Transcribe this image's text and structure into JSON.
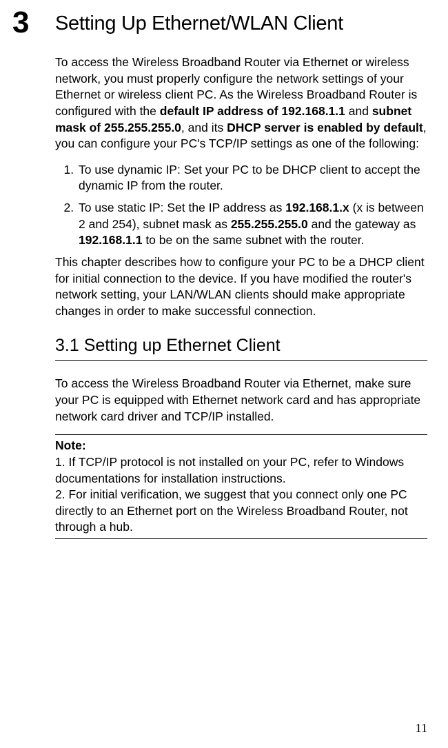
{
  "chapter": {
    "number": "3",
    "title": "Setting Up Ethernet/WLAN Client"
  },
  "intro": {
    "part1": "To access the Wireless Broadband Router via Ethernet or wireless network, you must properly configure the network settings of your Ethernet or wireless client PC. As the Wireless Broadband Router is configured with the ",
    "bold1": "default IP address of 192.168.1.1",
    "mid1": " and ",
    "bold2": "subnet mask of 255.255.255.0",
    "mid2": ", and its ",
    "bold3": "DHCP server is enabled by default",
    "part2": ", you can configure your PC's TCP/IP settings as one of the following:"
  },
  "list": {
    "item1": "To use dynamic IP: Set your PC to be DHCP client to accept the dynamic IP from the router.",
    "item2_a": "To use static IP: Set the IP address as ",
    "item2_b1": "192.168.1.x",
    "item2_c": " (x is between 2 and 254), subnet mask as ",
    "item2_b2": "255.255.255.0",
    "item2_d": " and the gateway as ",
    "item2_b3": "192.168.1.1",
    "item2_e": " to be on the same subnet with the router."
  },
  "after_list": "This chapter describes how to configure your PC to be a DHCP client for initial connection to the device. If you have modified the router's network setting, your LAN/WLAN clients should make appropriate changes in order to make successful connection.",
  "section": {
    "heading": "3.1 Setting up Ethernet Client",
    "body": "To access the Wireless Broadband Router via Ethernet, make sure your PC is equipped with Ethernet network card and has appropriate network card driver and TCP/IP installed."
  },
  "note": {
    "label": "Note:",
    "line1": "1. If TCP/IP protocol is not installed on your PC, refer to Windows documentations for installation instructions.",
    "line2": "2. For initial verification, we suggest that you connect only one PC directly to an Ethernet port on the Wireless Broadband Router, not through a hub."
  },
  "page_number": "11"
}
